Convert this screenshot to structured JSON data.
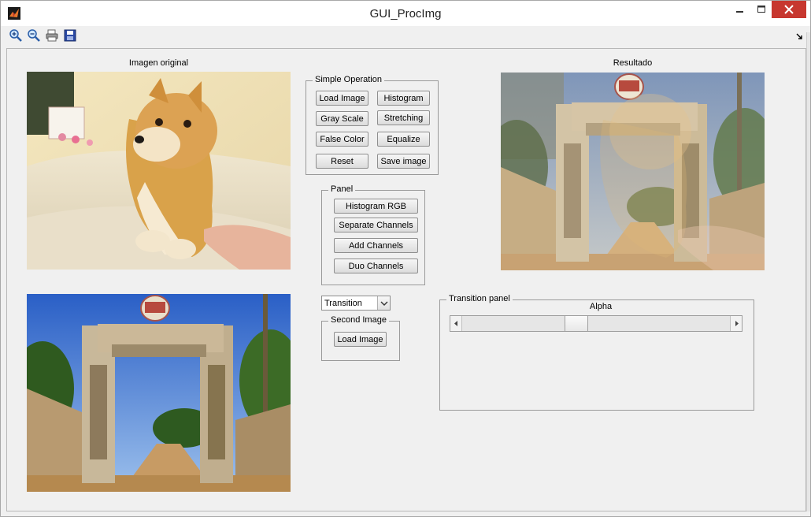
{
  "window": {
    "title": "GUI_ProcImg",
    "controls": [
      "minimize",
      "maximize",
      "close"
    ]
  },
  "toolbar": {
    "tools": [
      "zoom-in-icon",
      "zoom-out-icon",
      "print-icon",
      "save-icon"
    ]
  },
  "axes": {
    "original_label": "Imagen original",
    "result_label": "Resultado"
  },
  "simple_operation": {
    "title": "Simple Operation",
    "load_image": "Load Image",
    "histogram": "Histogram",
    "gray_scale": "Gray Scale",
    "stretching": "Stretching",
    "false_color": "False Color",
    "equalize": "Equalize",
    "reset": "Reset",
    "save_image": "Save image"
  },
  "panel": {
    "title": "Panel",
    "histogram_rgb": "Histogram RGB",
    "separate_channels": "Separate Channels",
    "add_channels": "Add Channels",
    "duo_channels": "Duo Channels"
  },
  "mode_select": {
    "value": "Transition"
  },
  "second_image": {
    "title": "Second Image",
    "load_image": "Load Image"
  },
  "transition_panel": {
    "title": "Transition panel",
    "alpha_label": "Alpha",
    "alpha_value_fraction": 0.42
  },
  "colors": {
    "background": "#f0f0f0",
    "close_button": "#c7372f"
  }
}
